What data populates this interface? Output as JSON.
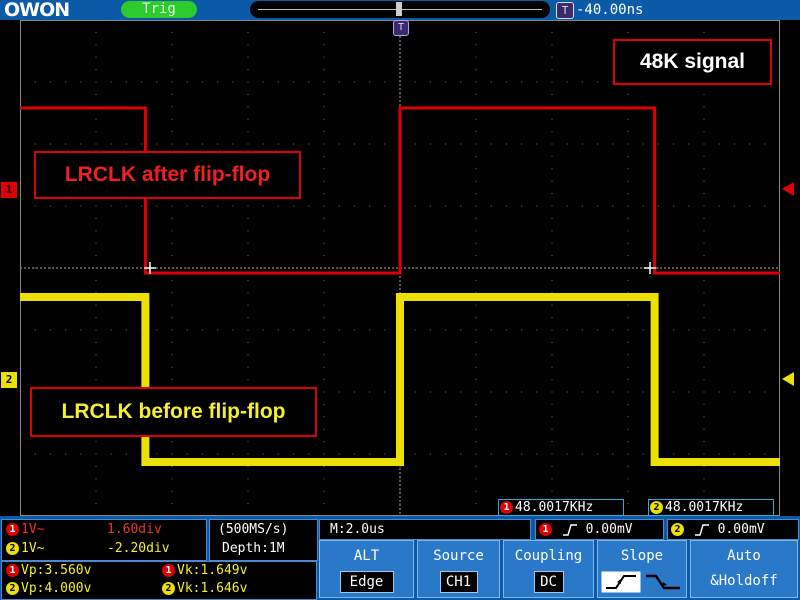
{
  "brand": "OWON",
  "header": {
    "trigger_status": "Trig",
    "trigger_offset": "-40.00ns",
    "trigger_badge": "T"
  },
  "annotations": {
    "title": "48K signal",
    "ch1_label": "LRCLK after flip-flop",
    "ch2_label": "LRCLK before flip-flop"
  },
  "channels": {
    "ch1": {
      "id": "1",
      "color": "#e00000"
    },
    "ch2": {
      "id": "2",
      "color": "#ece000"
    }
  },
  "frequency": {
    "ch1": "48.0017KHz",
    "ch2": "48.0017KHz"
  },
  "status": {
    "ch1_scale": "1V~",
    "ch1_offset": "1.60div",
    "ch2_scale": "1V~",
    "ch2_offset": "-2.20div",
    "sample_rate": "(500MS/s)",
    "depth": "Depth:1M",
    "ch1_vp": "Vp:3.560v",
    "ch1_vk": "Vk:1.649v",
    "ch2_vp": "Vp:4.000v",
    "ch2_vk": "Vk:1.646v",
    "timebase": "M:2.0us",
    "ch1_trigger_level": "0.00mV",
    "ch2_trigger_level": "0.00mV"
  },
  "menu": {
    "alt": {
      "title": "ALT",
      "value": "Edge"
    },
    "source": {
      "title": "Source",
      "value": "CH1"
    },
    "coupling": {
      "title": "Coupling",
      "value": "DC"
    },
    "slope": {
      "title": "Slope"
    },
    "auto": {
      "title": "Auto",
      "value": "&Holdoff"
    }
  },
  "waveform": {
    "ch1_levels": {
      "high": 1,
      "low": 0
    },
    "ch2_levels": {
      "high": 1,
      "low": 0
    },
    "edges_div": [
      1.65,
      5.0,
      8.35
    ]
  }
}
